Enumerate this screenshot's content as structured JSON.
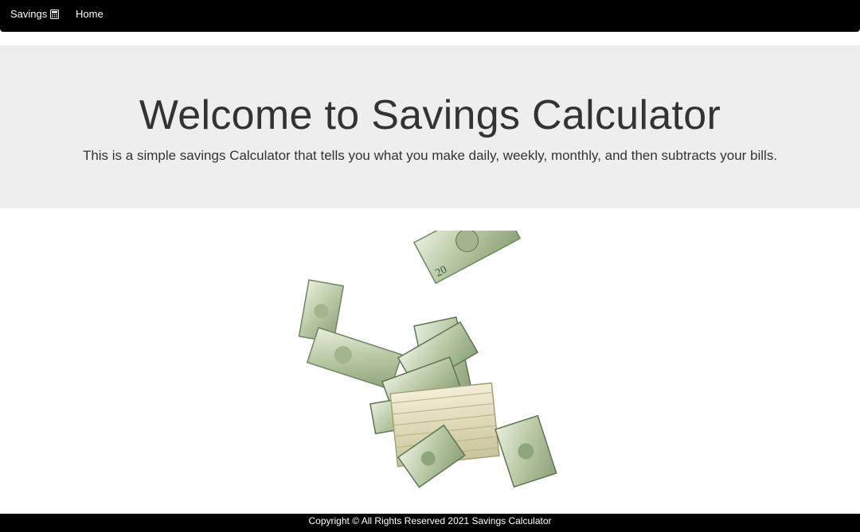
{
  "navbar": {
    "brand_label": "Savings",
    "brand_icon": "calculator-icon",
    "home_label": "Home"
  },
  "hero": {
    "title": "Welcome to Savings Calculator",
    "subtitle": "This is a simple savings Calculator that tells you what you make daily, weekly, monthly, and then subtracts your bills."
  },
  "image": {
    "alt": "Flying money"
  },
  "footer": {
    "copyright": "Copyright © All Rights Reserved 2021 Savings Calculator"
  },
  "colors": {
    "navbar_bg": "#000000",
    "jumbotron_bg": "#eeeeee",
    "text": "#333333",
    "money_green": "#9fb58c"
  }
}
